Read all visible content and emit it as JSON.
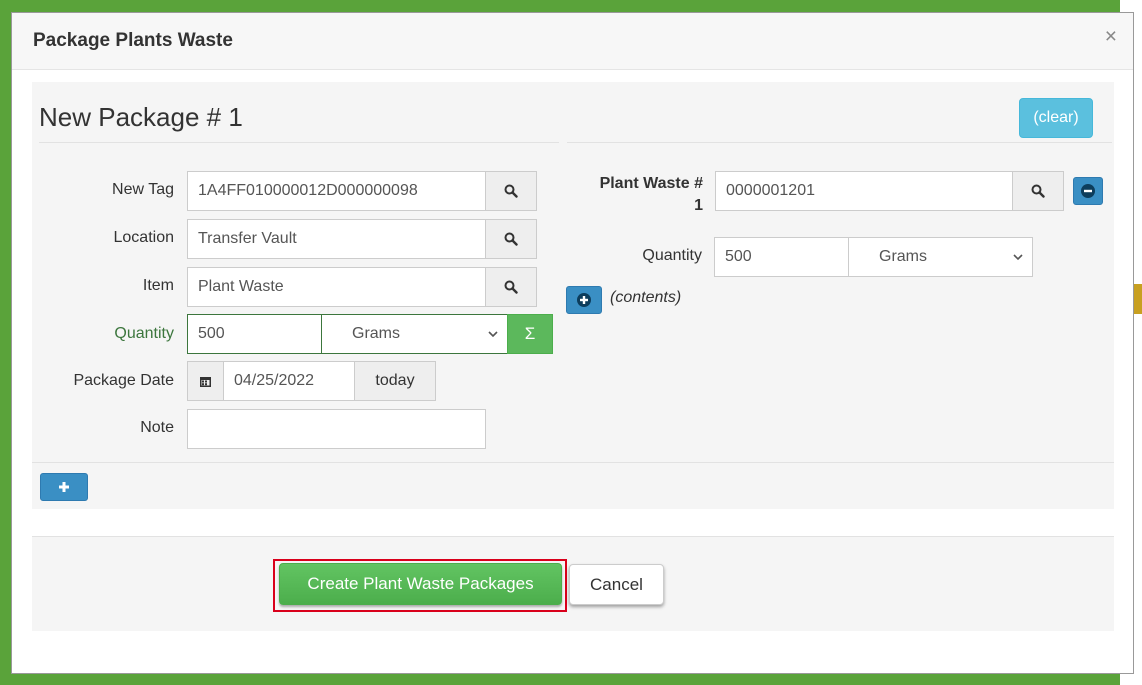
{
  "modal": {
    "title": "Package Plants Waste",
    "close_symbol": "×"
  },
  "package": {
    "title": "New Package # 1",
    "clear_label": "(clear)",
    "new_tag": {
      "label": "New Tag",
      "value": "1A4FF010000012D000000098"
    },
    "location": {
      "label": "Location",
      "value": "Transfer Vault"
    },
    "item": {
      "label": "Item",
      "value": "Plant Waste"
    },
    "quantity": {
      "label": "Quantity",
      "value": "500",
      "unit": "Grams",
      "sigma": "Σ"
    },
    "package_date": {
      "label": "Package Date",
      "value": "04/25/2022",
      "today_label": "today"
    },
    "note": {
      "label": "Note",
      "value": ""
    }
  },
  "plant_waste": {
    "label_line1": "Plant Waste #",
    "label_line2": "1",
    "value": "0000001201",
    "quantity_label": "Quantity",
    "quantity_value": "500",
    "quantity_unit": "Grams",
    "contents_label": "(contents)"
  },
  "footer": {
    "create_label": "Create Plant Waste Packages",
    "cancel_label": "Cancel"
  },
  "colors": {
    "frame_green": "#5aa33a",
    "primary_info": "#5bc0de",
    "success": "#5cb85c",
    "highlight_red": "#d9001b"
  },
  "icons": [
    "search-icon",
    "calendar-icon",
    "minus-circle-icon",
    "plus-circle-icon",
    "plus-icon",
    "chevron-down-icon",
    "close-icon"
  ]
}
